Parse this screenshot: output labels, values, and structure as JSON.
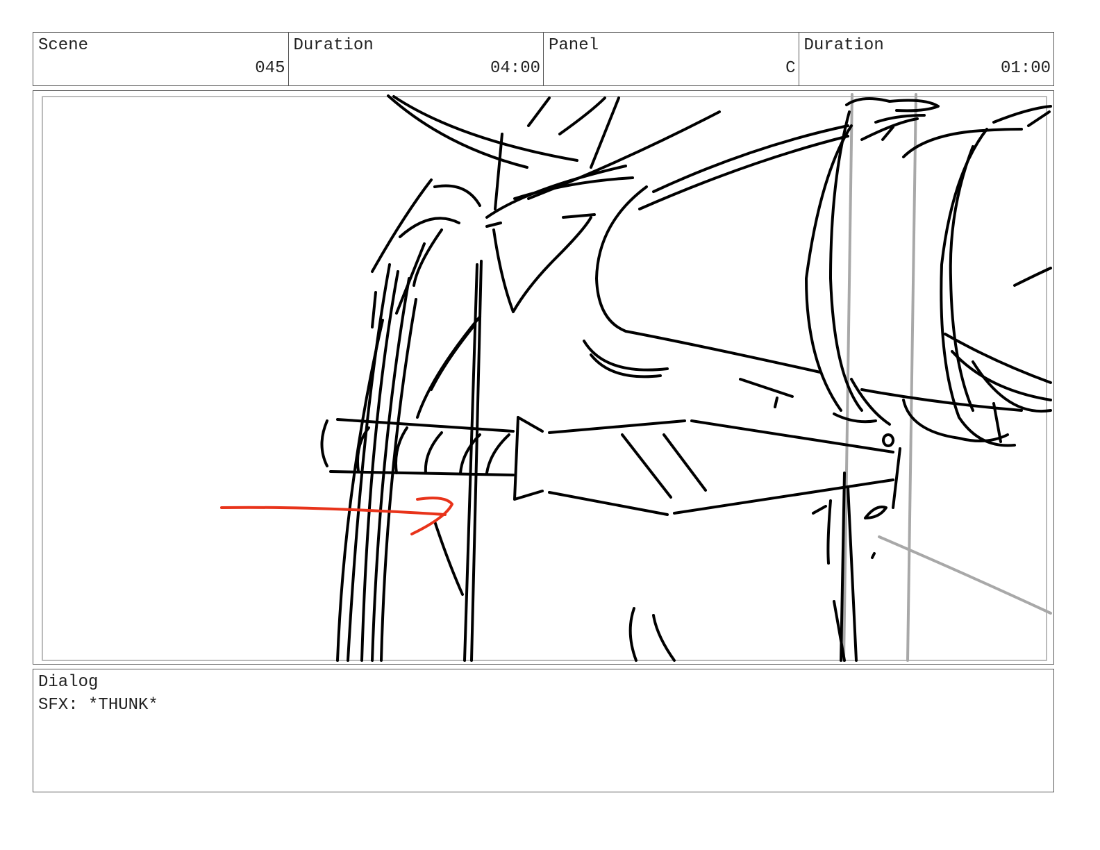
{
  "header": {
    "scene_label": "Scene",
    "scene_value": "045",
    "scene_duration_label": "Duration",
    "scene_duration_value": "04:00",
    "panel_label": "Panel",
    "panel_value": "C",
    "panel_duration_label": "Duration",
    "panel_duration_value": "01:00"
  },
  "dialog": {
    "label": "Dialog",
    "text": "SFX: *THUNK*"
  },
  "colors": {
    "ink": "#000000",
    "guide": "#a8a8a8",
    "arrow": "#e8331a",
    "border": "#555555"
  }
}
